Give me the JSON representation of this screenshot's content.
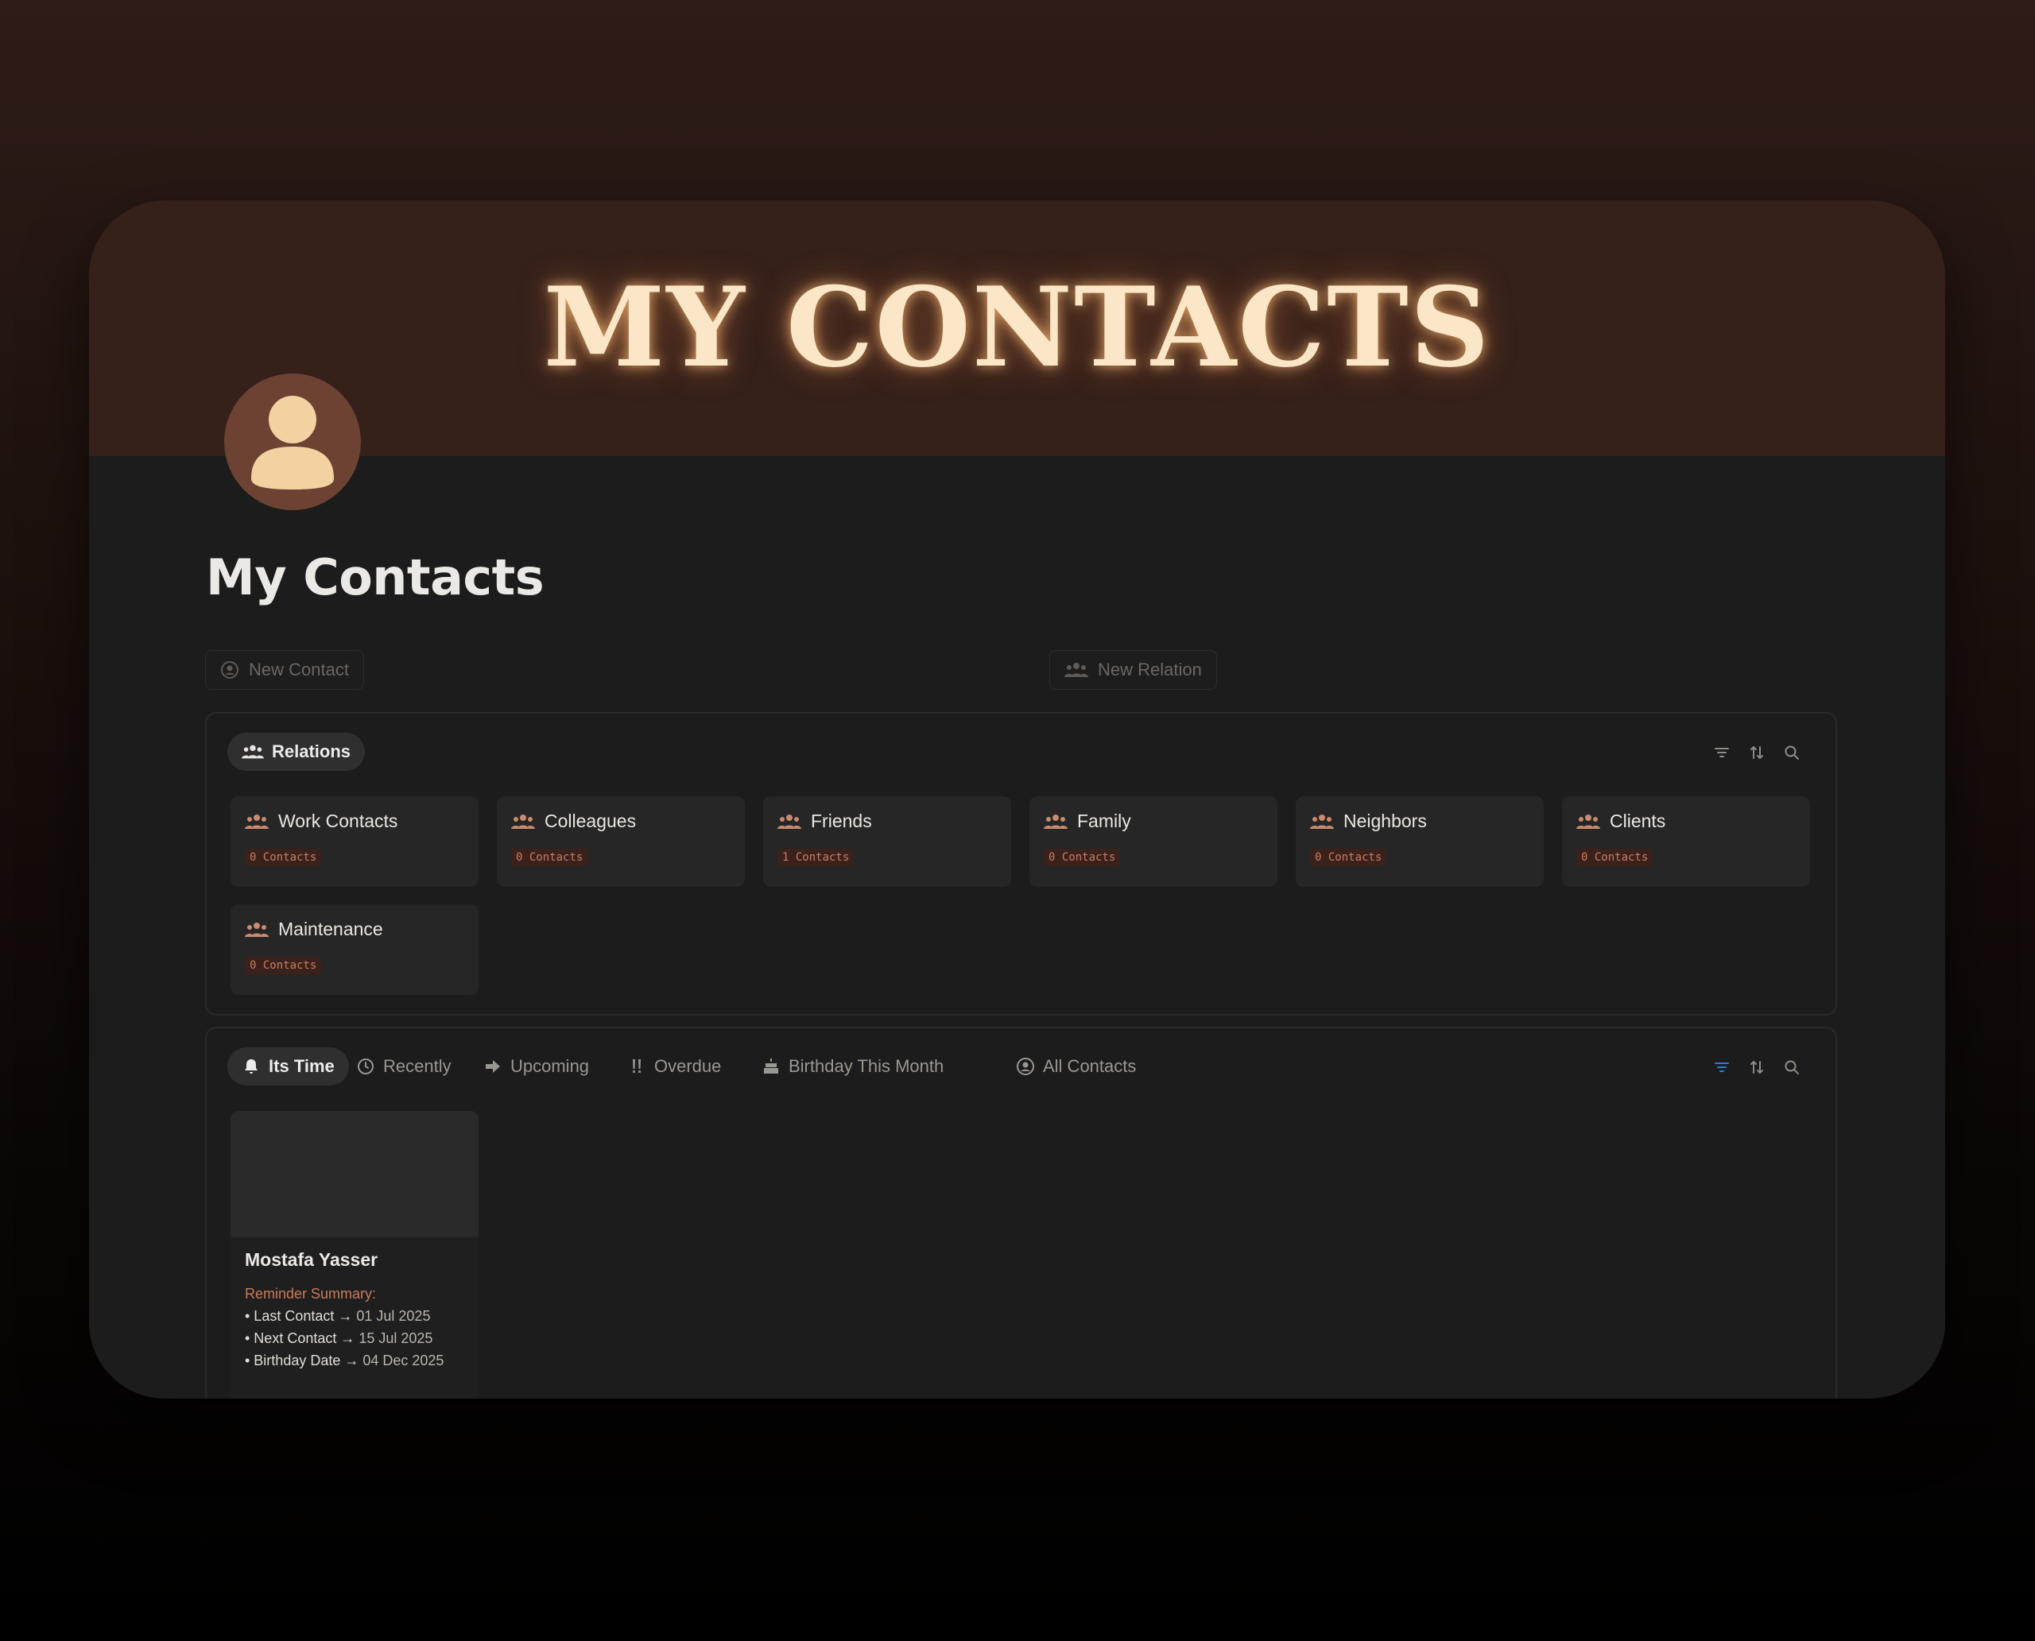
{
  "cover": {
    "title": "MY CONTACTS"
  },
  "page": {
    "title": "My Contacts"
  },
  "actions": {
    "new_contact": "New Contact",
    "new_relation": "New Relation"
  },
  "relations": {
    "tab_label": "Relations",
    "cards": [
      {
        "name": "Work Contacts",
        "count": "0 Contacts"
      },
      {
        "name": "Colleagues",
        "count": "0 Contacts"
      },
      {
        "name": "Friends",
        "count": "1 Contacts"
      },
      {
        "name": "Family",
        "count": "0 Contacts"
      },
      {
        "name": "Neighbors",
        "count": "0 Contacts"
      },
      {
        "name": "Clients",
        "count": "0 Contacts"
      },
      {
        "name": "Maintenance",
        "count": "0 Contacts"
      }
    ]
  },
  "views": {
    "tabs": [
      {
        "label": "Its Time",
        "icon": "bell-icon",
        "active": true
      },
      {
        "label": "Recently",
        "icon": "clock-icon"
      },
      {
        "label": "Upcoming",
        "icon": "arrow-right-icon"
      },
      {
        "label": "Overdue",
        "icon": "double-exclamation-icon"
      },
      {
        "label": "Birthday This Month",
        "icon": "cake-icon"
      },
      {
        "label": "All Contacts",
        "icon": "user-circle-icon"
      }
    ]
  },
  "contact": {
    "name": "Mostafa Yasser",
    "reminder_title": "Reminder Summary:",
    "lines": [
      {
        "label": "• Last Contact → ",
        "date": "01 Jul 2025"
      },
      {
        "label": "• Next Contact → ",
        "date": "15 Jul 2025"
      },
      {
        "label": "• Birthday Date → ",
        "date": "04 Dec 2025"
      }
    ]
  },
  "colors": {
    "accent": "#c87e63",
    "cover": "#35201a",
    "filter_active": "#2e7dd6"
  }
}
